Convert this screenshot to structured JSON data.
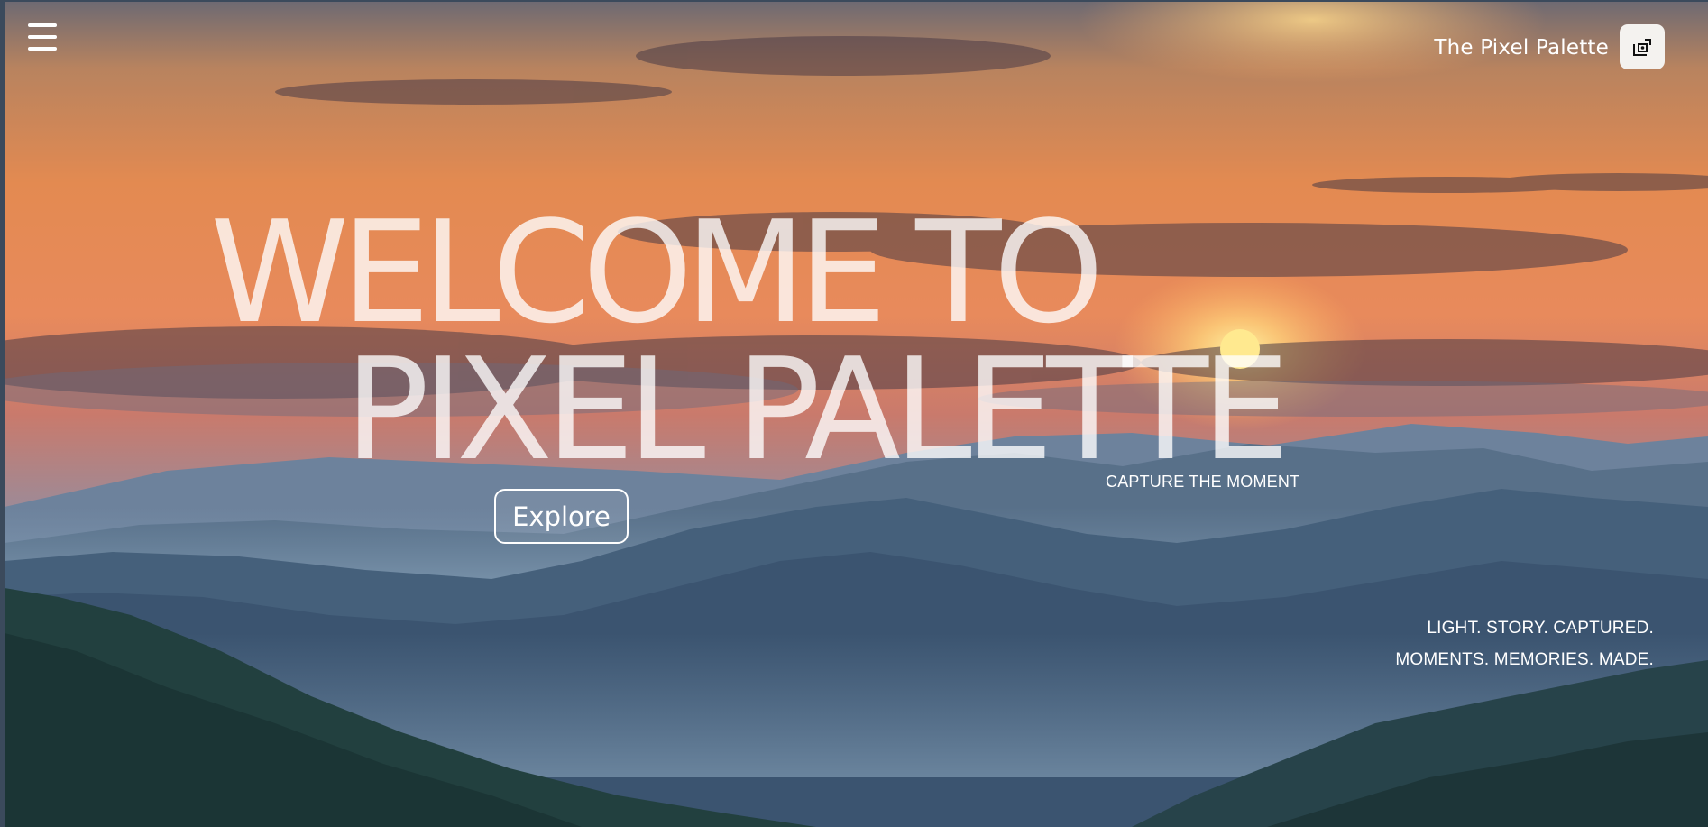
{
  "header": {
    "menu_icon": "hamburger-menu-icon",
    "brand_name": "The Pixel Palette",
    "brand_icon": "photo-frame-icon"
  },
  "hero": {
    "headline_line1": "WELCOME TO",
    "headline_line2": "PIXEL PALETTE",
    "tagline": "CAPTURE THE MOMENT",
    "explore_label": "Explore",
    "motto_line1": "LIGHT. STORY. CAPTURED.",
    "motto_line2": "MOMENTS. MEMORIES. MADE."
  },
  "colors": {
    "sky_top": "#6e6f7e",
    "sky_orange": "#e98a4c",
    "sun": "#ffe27a",
    "mountain_far": "#6d829c",
    "mountain_mid": "#3e5670",
    "forest_dark": "#1f3a3f",
    "text": "#ffffff"
  }
}
